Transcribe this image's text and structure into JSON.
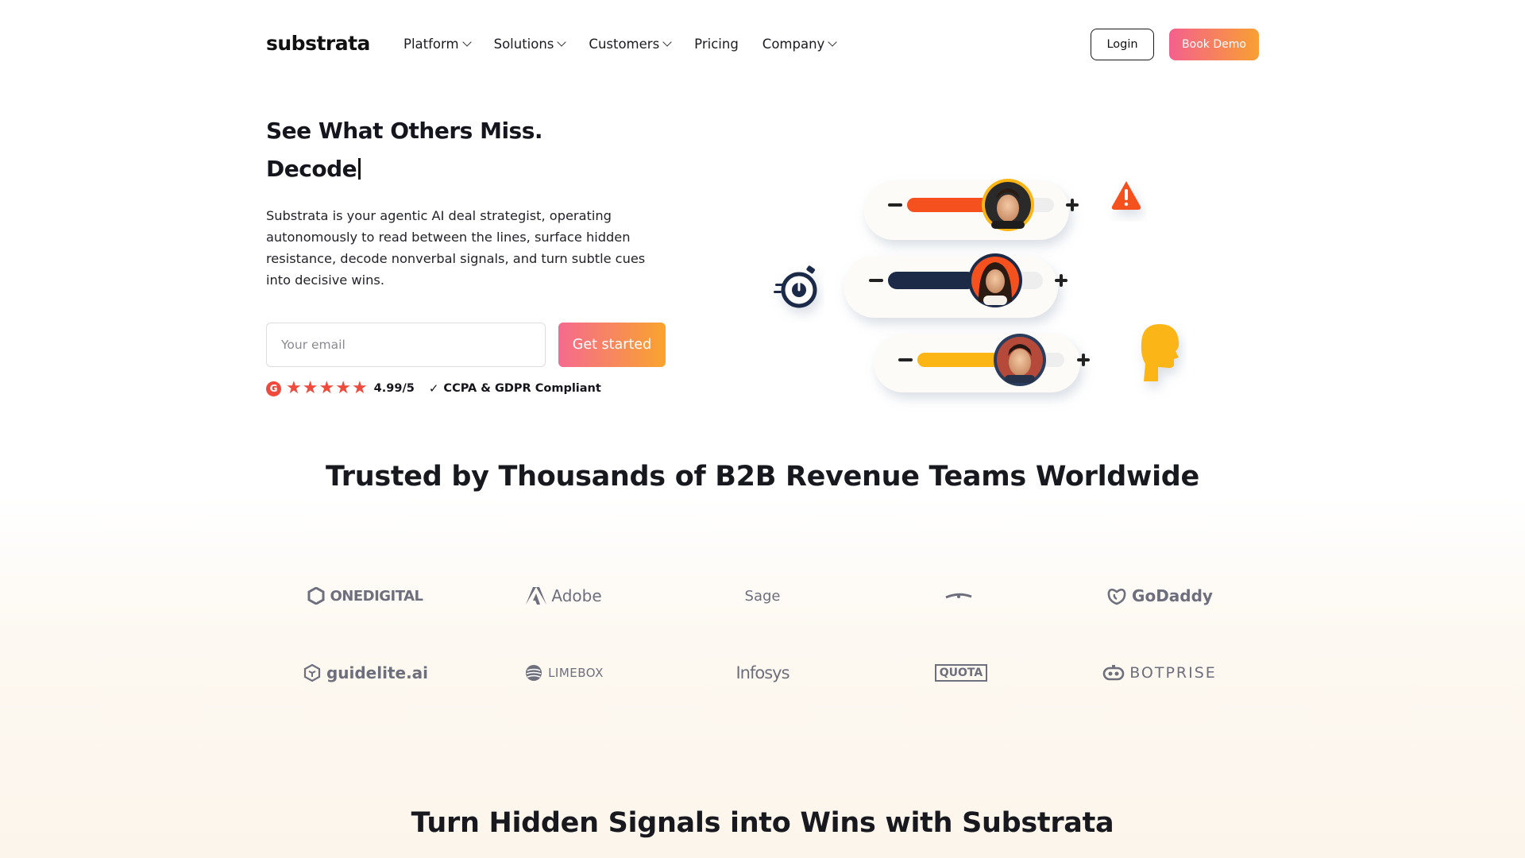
{
  "nav": {
    "logo": "substrata",
    "items": [
      {
        "label": "Platform",
        "dropdown": true
      },
      {
        "label": "Solutions",
        "dropdown": true
      },
      {
        "label": "Customers",
        "dropdown": true
      },
      {
        "label": "Pricing",
        "dropdown": false
      },
      {
        "label": "Company",
        "dropdown": true
      }
    ],
    "login": "Login",
    "book_demo": "Book Demo"
  },
  "hero": {
    "headline": "See What Others Miss.",
    "typed_word": "Decode",
    "description": "Substrata is your agentic AI deal strategist, operating autonomously to read between the lines, surface hidden resistance, decode nonverbal signals, and turn subtle cues into decisive wins.",
    "email_placeholder": "Your email",
    "cta": "Get started",
    "g2_letter": "G",
    "rating": "4.99/5",
    "star_count": 5,
    "compliance": "CCPA & GDPR Compliant"
  },
  "illustration": {
    "bars": [
      {
        "color": "#f4511e",
        "fill": 0.62
      },
      {
        "color": "#1c2a48",
        "fill": 0.57
      },
      {
        "color": "#fbb515",
        "fill": 0.62
      }
    ],
    "colors": {
      "alert": "#f4511e",
      "timer": "#1c2a48",
      "head": "#fbb515"
    }
  },
  "trusted": {
    "title": "Trusted by Thousands of B2B Revenue Teams Worldwide",
    "rows": [
      [
        {
          "name": "ONEDIGITAL",
          "icon": "onedigital-icon"
        },
        {
          "name": "Adobe",
          "icon": "adobe-icon"
        },
        {
          "name": "Sage",
          "icon": ""
        },
        {
          "name": "",
          "icon": "partial-logo-icon"
        },
        {
          "name": "GoDaddy",
          "icon": "godaddy-icon"
        }
      ],
      [
        {
          "name": "guidelite.ai",
          "icon": "guidelite-icon"
        },
        {
          "name": "LIMEBOX",
          "icon": "limebox-icon"
        },
        {
          "name": "Infosys",
          "icon": ""
        },
        {
          "name": "QUOTA",
          "icon": "quota-icon"
        },
        {
          "name": "BOTPRISE",
          "icon": "botprise-icon"
        }
      ]
    ]
  },
  "section2": {
    "title": "Turn Hidden Signals into Wins with Substrata"
  }
}
